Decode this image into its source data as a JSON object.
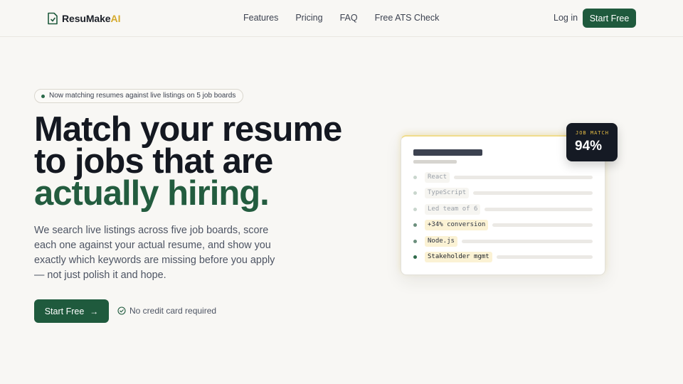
{
  "brand": {
    "name_part1": "ResuMake",
    "name_part2": "AI"
  },
  "nav": {
    "links": [
      "Features",
      "Pricing",
      "FAQ",
      "Free ATS Check"
    ],
    "login": "Log in",
    "cta": "Start Free"
  },
  "hero": {
    "pill": "Now matching resumes against live listings on 5 job boards",
    "headline_line1": "Match your resume",
    "headline_line2": "to jobs that are",
    "headline_line3": "actually hiring.",
    "subtext": "We search live listings across five job boards, score each one against your actual resume, and show you exactly which keywords are missing before you apply — not just polish it and hope.",
    "cta": "Start Free",
    "cta_icon": "arrow-right-icon",
    "note": "No credit card required",
    "note_icon": "check-circle-icon"
  },
  "card": {
    "keywords": [
      {
        "text": "React",
        "state": "dim"
      },
      {
        "text": "TypeScript",
        "state": "dim"
      },
      {
        "text": "Led team of 6",
        "state": "dim"
      },
      {
        "text": "+34% conversion",
        "state": "hit"
      },
      {
        "text": "Node.js",
        "state": "hit"
      },
      {
        "text": "Stakeholder mgmt",
        "state": "hit2"
      }
    ],
    "badge_label": "JOB MATCH",
    "badge_value": "94%"
  },
  "colors": {
    "brand_green": "#1f5a3d",
    "accent_yellow": "#d5aa2d",
    "dark": "#151a24"
  }
}
